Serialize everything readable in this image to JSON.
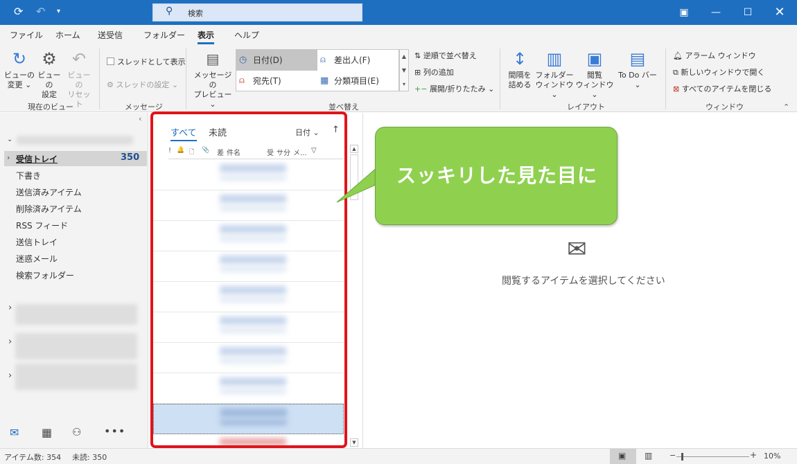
{
  "titlebar": {
    "search_placeholder": "検索",
    "icons": [
      "sync-icon",
      "undo-icon",
      "quick-access-dropdown-icon",
      "search-icon",
      "ribbon-display-icon",
      "minimize-icon",
      "maximize-icon",
      "close-icon"
    ]
  },
  "menu": {
    "tabs": [
      "ファイル",
      "ホーム",
      "送受信",
      "フォルダー",
      "表示",
      "ヘルプ"
    ],
    "active_tab": "表示"
  },
  "ribbon": {
    "current_view": {
      "label": "現在のビュー",
      "change_view": [
        "ビューの",
        "変更 ⌄"
      ],
      "view_settings": [
        "ビューの",
        "設定"
      ],
      "reset_view": [
        "ビューの",
        "リセット"
      ]
    },
    "messages": {
      "label": "メッセージ",
      "show_as_conversations": "スレッドとして表示",
      "conversation_settings": "スレッドの設定 ⌄"
    },
    "arrangement": {
      "label": "並べ替え",
      "message_preview": [
        "メッセージの",
        "プレビュー ⌄"
      ],
      "gallery": {
        "date": "日付(D)",
        "from": "差出人(F)",
        "to": "宛先(T)",
        "categories": "分類項目(E)"
      },
      "reverse_sort": "逆順で並べ替え",
      "add_columns": "列の追加",
      "expand_collapse": "展開/折りたたみ ⌄"
    },
    "layout": {
      "label": "レイアウト",
      "compact": [
        "間隔を",
        "詰める"
      ],
      "folder_pane": [
        "フォルダー",
        "ウィンドウ ⌄"
      ],
      "reading_pane": [
        "閲覧",
        "ウィンドウ ⌄"
      ],
      "todo_bar": [
        "To Do バー",
        "⌄"
      ]
    },
    "window": {
      "label": "ウィンドウ",
      "reminders": "アラーム ウィンドウ",
      "open_new_window": "新しいウィンドウで開く",
      "close_all_items": "すべてのアイテムを閉じる"
    }
  },
  "nav": {
    "folders": [
      "受信トレイ",
      "下書き",
      "送信済みアイテム",
      "削除済みアイテム",
      "RSS フィード",
      "送信トレイ",
      "迷惑メール",
      "検索フォルダー"
    ],
    "inbox_count": "350"
  },
  "list": {
    "filter_all": "すべて",
    "filter_unread": "未読",
    "sort_by": "日付 ⌄",
    "sort_direction": "↑",
    "column_headers": [
      "!",
      "🔔",
      "🗋",
      "📎",
      "差",
      "件名",
      "受",
      "サ",
      "分",
      "メ...",
      "▽"
    ]
  },
  "reading": {
    "empty_message": "閲覧するアイテムを選択してください"
  },
  "callout": {
    "text": "スッキリした見た目に"
  },
  "status": {
    "item_count": "アイテム数: 354",
    "unread_count": "未読: 350",
    "zoom": "10%"
  },
  "colors": {
    "titlebar": "#1f6fc1",
    "accent": "#1f6fc1",
    "callout_fill": "#8fd14f",
    "highlight_border": "#e0141a",
    "selected_row": "#cde0f4"
  }
}
